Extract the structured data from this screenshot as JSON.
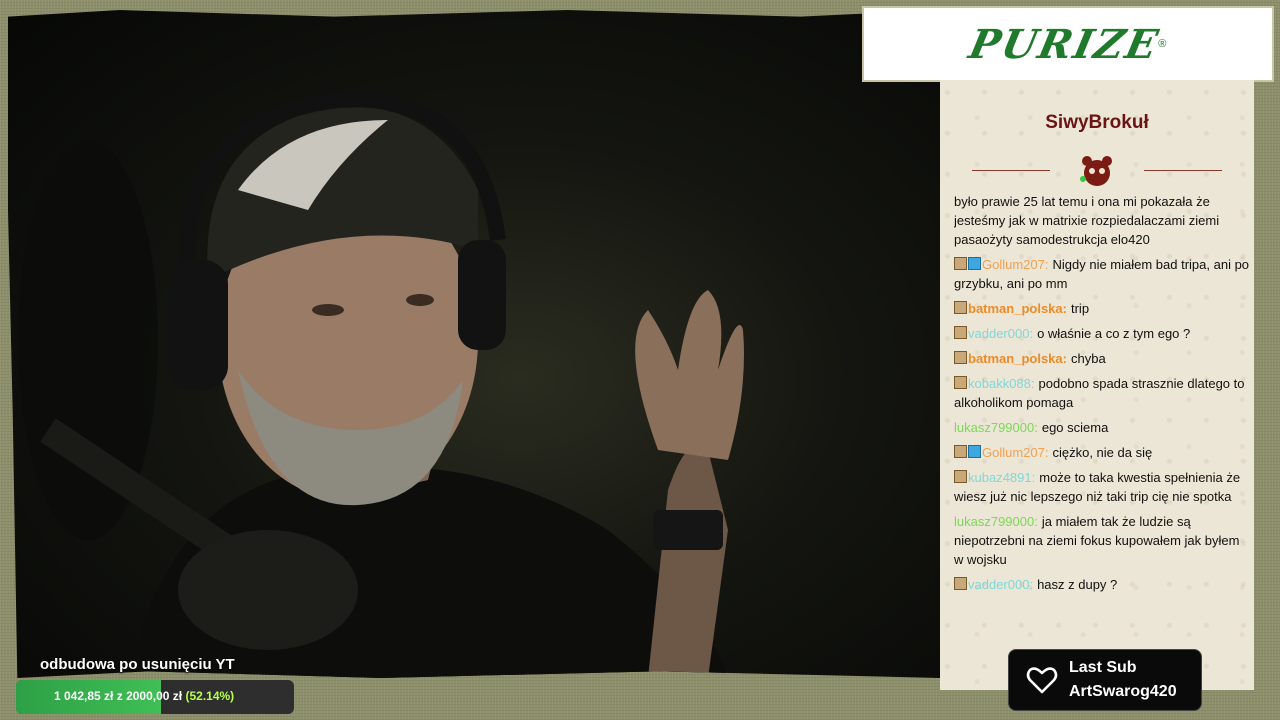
{
  "logo": {
    "text": "PURIZE",
    "mark": "®"
  },
  "chat": {
    "title": "SiwyBrokuł",
    "messages": [
      {
        "user": "",
        "user_color": "",
        "text": "było prawie 25 lat temu i ona mi pokazała że jesteśmy jak w matrixie rozpiedalaczami ziemi pasaożyty samodestrukcja elo420",
        "badges": []
      },
      {
        "user": "Gollum207:",
        "user_color": "u-orange-light",
        "text": "Nigdy nie miałem bad tripa, ani po grzybku, ani po mm",
        "badges": [
          "sub",
          "gem"
        ]
      },
      {
        "user": "batman_polska:",
        "user_color": "u-orange",
        "text": "trip",
        "badges": [
          "sub"
        ]
      },
      {
        "user": "vadder000:",
        "user_color": "u-cyan",
        "text": "o właśnie a co z tym ego ?",
        "badges": [
          "sub"
        ]
      },
      {
        "user": "batman_polska:",
        "user_color": "u-orange",
        "text": "chyba",
        "badges": [
          "sub"
        ]
      },
      {
        "user": "kobakk088:",
        "user_color": "u-cyan",
        "text": "podobno spada strasznie dlatego to alkoholikom pomaga",
        "badges": [
          "sub"
        ]
      },
      {
        "user": "lukasz799000:",
        "user_color": "u-green",
        "text": "ego sciema",
        "badges": []
      },
      {
        "user": "Gollum207:",
        "user_color": "u-orange-light",
        "text": "ciężko, nie da się",
        "badges": [
          "sub",
          "gem"
        ]
      },
      {
        "user": "kubaz4891:",
        "user_color": "u-cyan",
        "text": "może to taka kwestia spełnienia że wiesz już nic lepszego niż taki trip cię nie spotka",
        "badges": [
          "sub"
        ]
      },
      {
        "user": "lukasz799000:",
        "user_color": "u-green",
        "text": "ja miałem tak że ludzie są niepotrzebni na ziemi fokus kupowałem jak byłem w wojsku",
        "badges": []
      },
      {
        "user": "vadder000:",
        "user_color": "u-cyan",
        "text": "hasz z dupy ?",
        "badges": [
          "sub"
        ]
      }
    ]
  },
  "last_sub": {
    "label": "Last Sub",
    "name": "ArtSwarog420",
    "icon": "heart-icon"
  },
  "goal": {
    "title": "odbudowa po usunięciu YT",
    "current": "1 042,85 zł",
    "separator": "z",
    "target": "2000,00 zł",
    "percent_text": "(52.14%)",
    "progress": 0.5214
  },
  "colors": {
    "accent_green": "#3fbf55",
    "title_red": "#6b1414",
    "panel_bg": "#ece6d6"
  }
}
